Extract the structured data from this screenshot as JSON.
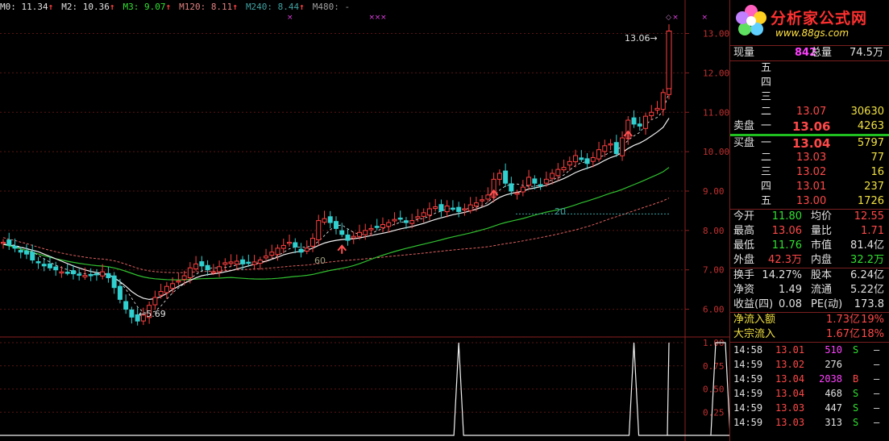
{
  "ma_bar": [
    {
      "label": "M0: 11.34",
      "color": "#e0e0e0"
    },
    {
      "label": "M2: 10.36",
      "color": "#e0e0e0"
    },
    {
      "label": "M3: 9.07",
      "color": "#30e030"
    },
    {
      "label": "M120: 8.11",
      "color": "#e08080"
    },
    {
      "label": "M240: 8.44",
      "color": "#40a0a0"
    },
    {
      "label": "M480: -",
      "color": "#a0a0a0"
    }
  ],
  "chart_data": {
    "type": "candlestick",
    "price_axis": {
      "ticks": [
        "13.00",
        "12.00",
        "11.00",
        "10.00",
        "9.00",
        "8.00",
        "7.00",
        "6.00"
      ],
      "min": 5.5,
      "max": 13.4
    },
    "indicator_axis": {
      "ticks": [
        "1.00",
        "0.75",
        "0.50",
        "0.25"
      ],
      "min": 0,
      "max": 1
    },
    "annotations": {
      "high": "13.06",
      "low": "5.69",
      "label_60": "60",
      "label_20": "20"
    },
    "closes": [
      7.7,
      7.62,
      7.55,
      7.45,
      7.4,
      7.25,
      7.18,
      7.1,
      7.05,
      7.0,
      6.95,
      6.92,
      6.9,
      6.88,
      6.86,
      6.85,
      6.88,
      6.95,
      6.8,
      6.55,
      6.25,
      6.0,
      5.8,
      5.7,
      5.85,
      6.1,
      6.3,
      6.45,
      6.58,
      6.65,
      6.72,
      6.85,
      7.05,
      7.15,
      7.1,
      7.0,
      6.95,
      7.08,
      7.18,
      7.2,
      7.22,
      7.15,
      7.18,
      7.2,
      7.25,
      7.35,
      7.45,
      7.55,
      7.62,
      7.7,
      7.58,
      7.45,
      7.55,
      7.8,
      8.25,
      8.3,
      8.2,
      8.05,
      7.9,
      7.75,
      7.85,
      7.95,
      8.0,
      8.05,
      8.1,
      8.15,
      8.2,
      8.28,
      8.3,
      8.2,
      8.25,
      8.35,
      8.45,
      8.55,
      8.6,
      8.5,
      8.62,
      8.55,
      8.48,
      8.55,
      8.65,
      8.7,
      8.78,
      8.9,
      9.3,
      9.45,
      9.2,
      9.0,
      8.95,
      9.1,
      9.35,
      9.2,
      9.15,
      9.3,
      9.45,
      9.55,
      9.6,
      9.75,
      9.9,
      9.8,
      9.7,
      9.85,
      10.05,
      10.15,
      10.2,
      9.95,
      10.35,
      10.8,
      10.7,
      10.65,
      10.9,
      11.0,
      11.1,
      11.5,
      13.06
    ],
    "ma_white": [
      7.65,
      7.63,
      7.6,
      7.57,
      7.54,
      7.5,
      7.46,
      7.4,
      7.34,
      7.28,
      7.22,
      7.16,
      7.1,
      7.05,
      7.0,
      6.96,
      6.93,
      6.91,
      6.88,
      6.8,
      6.7,
      6.58,
      6.45,
      6.35,
      6.28,
      6.25,
      6.27,
      6.32,
      6.4,
      6.5,
      6.58,
      6.66,
      6.73,
      6.8,
      6.85,
      6.88,
      6.9,
      6.92,
      6.95,
      6.98,
      7.02,
      7.06,
      7.1,
      7.14,
      7.18,
      7.22,
      7.27,
      7.32,
      7.38,
      7.42,
      7.45,
      7.47,
      7.5,
      7.55,
      7.62,
      7.68,
      7.72,
      7.75,
      7.77,
      7.78,
      7.79,
      7.81,
      7.84,
      7.87,
      7.9,
      7.93,
      7.96,
      8.0,
      8.04,
      8.07,
      8.1,
      8.14,
      8.18,
      8.23,
      8.28,
      8.32,
      8.36,
      8.4,
      8.43,
      8.46,
      8.5,
      8.54,
      8.59,
      8.65,
      8.75,
      8.84,
      8.9,
      8.94,
      8.97,
      9.0,
      9.05,
      9.08,
      9.11,
      9.15,
      9.2,
      9.26,
      9.32,
      9.39,
      9.47,
      9.53,
      9.58,
      9.63,
      9.7,
      9.78,
      9.85,
      9.9,
      9.98,
      10.08,
      10.16,
      10.22,
      10.3,
      10.4,
      10.5,
      10.62,
      10.85
    ],
    "indicator_peaks": [
      78,
      108,
      122,
      157,
      177
    ]
  },
  "side": {
    "logo_text": "分析家公式网",
    "logo_url": "www.88gs.com",
    "now_label": "现量",
    "now_val": "842",
    "total_label": "总量",
    "total_val": "74.5万",
    "asks": [
      {
        "lvl": "五",
        "price": "",
        "vol": ""
      },
      {
        "lvl": "四",
        "price": "",
        "vol": ""
      },
      {
        "lvl": "三",
        "price": "",
        "vol": ""
      },
      {
        "lvl": "二",
        "price": "13.07",
        "vol": "30630"
      }
    ],
    "ask1": {
      "label": "卖盘",
      "lvl": "一",
      "price": "13.06",
      "vol": "4263"
    },
    "bid1": {
      "label": "买盘",
      "lvl": "一",
      "price": "13.04",
      "vol": "5797"
    },
    "bids": [
      {
        "lvl": "二",
        "price": "13.03",
        "vol": "77"
      },
      {
        "lvl": "三",
        "price": "13.02",
        "vol": "16"
      },
      {
        "lvl": "四",
        "price": "13.01",
        "vol": "237"
      },
      {
        "lvl": "五",
        "price": "13.00",
        "vol": "1726"
      }
    ],
    "stats": [
      [
        {
          "t": "今开",
          "c": "w"
        },
        {
          "t": "11.80",
          "c": "g"
        },
        {
          "t": "均价",
          "c": "w"
        },
        {
          "t": "12.55",
          "c": "r"
        }
      ],
      [
        {
          "t": "最高",
          "c": "w"
        },
        {
          "t": "13.06",
          "c": "r"
        },
        {
          "t": "量比",
          "c": "w"
        },
        {
          "t": "1.71",
          "c": "r"
        }
      ],
      [
        {
          "t": "最低",
          "c": "w"
        },
        {
          "t": "11.76",
          "c": "g"
        },
        {
          "t": "市值",
          "c": "w"
        },
        {
          "t": "81.4亿",
          "c": "w"
        }
      ],
      [
        {
          "t": "外盘",
          "c": "w"
        },
        {
          "t": "42.3万",
          "c": "r"
        },
        {
          "t": "内盘",
          "c": "w"
        },
        {
          "t": "32.2万",
          "c": "g"
        }
      ]
    ],
    "stats2": [
      [
        {
          "t": "换手",
          "c": "w"
        },
        {
          "t": "14.27%",
          "c": "w"
        },
        {
          "t": "股本",
          "c": "w"
        },
        {
          "t": "6.24亿",
          "c": "w"
        }
      ],
      [
        {
          "t": "净资",
          "c": "w"
        },
        {
          "t": "1.49",
          "c": "w"
        },
        {
          "t": "流通",
          "c": "w"
        },
        {
          "t": "5.22亿",
          "c": "w"
        }
      ],
      [
        {
          "t": "收益(四)",
          "c": "w"
        },
        {
          "t": "0.08",
          "c": "w"
        },
        {
          "t": "PE(动)",
          "c": "w"
        },
        {
          "t": "173.8",
          "c": "w"
        }
      ]
    ],
    "flows": [
      {
        "label": "净流入额",
        "val": "1.73亿",
        "pct": "19%"
      },
      {
        "label": "大宗流入",
        "val": "1.67亿",
        "pct": "18%"
      }
    ],
    "ticks": [
      {
        "time": "14:58",
        "price": "13.01",
        "vol": "510",
        "flag": "S",
        "vc": "m",
        "fc": "g"
      },
      {
        "time": "14:59",
        "price": "13.02",
        "vol": "276",
        "flag": "",
        "vc": "w",
        "fc": "w"
      },
      {
        "time": "14:59",
        "price": "13.04",
        "vol": "2038",
        "flag": "B",
        "vc": "m",
        "fc": "r"
      },
      {
        "time": "14:59",
        "price": "13.04",
        "vol": "468",
        "flag": "S",
        "vc": "w",
        "fc": "g"
      },
      {
        "time": "14:59",
        "price": "13.03",
        "vol": "447",
        "flag": "S",
        "vc": "w",
        "fc": "g"
      },
      {
        "time": "14:59",
        "price": "13.03",
        "vol": "313",
        "flag": "S",
        "vc": "w",
        "fc": "g"
      }
    ]
  }
}
